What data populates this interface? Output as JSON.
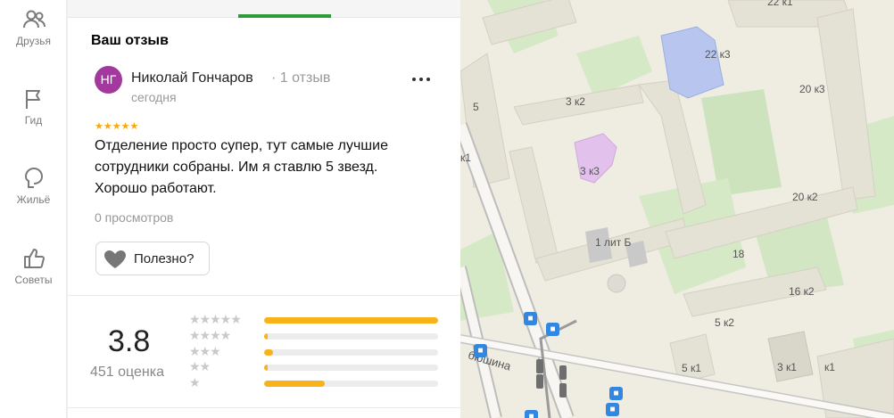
{
  "sidebar": {
    "items": [
      {
        "label": "Друзья",
        "icon": "friends-icon"
      },
      {
        "label": "Гид",
        "icon": "flag-icon"
      },
      {
        "label": "Жильё",
        "icon": "house-icon"
      },
      {
        "label": "Советы",
        "icon": "thumbs-up-icon"
      }
    ]
  },
  "review": {
    "section_title": "Ваш отзыв",
    "avatar_initials": "НГ",
    "avatar_color": "#a3389f",
    "author": "Николай Гончаров",
    "author_meta": "· 1 отзыв",
    "date": "сегодня",
    "stars": "★★★★★",
    "rating": 5,
    "text": "Отделение просто супер, тут самые лучшие сотрудники собраны. Им я ставлю 5 звезд. Хорошо работают.",
    "views": "0 просмотров",
    "useful_label": "Полезно?"
  },
  "summary": {
    "rating_value": "3.8",
    "rating_count": "451 оценка",
    "distribution": [
      {
        "stars": "★★★★★",
        "fraction": 1.0
      },
      {
        "stars": "★★★★",
        "fraction": 0.02
      },
      {
        "stars": "★★★",
        "fraction": 0.05
      },
      {
        "stars": "★★",
        "fraction": 0.02
      },
      {
        "stars": "★",
        "fraction": 0.35
      }
    ]
  },
  "colors": {
    "accent_green": "#2f9a3a",
    "star_yellow": "#f7a90f",
    "bar_yellow": "#f7b319"
  },
  "map": {
    "labels": [
      "22 к3",
      "20 к3",
      "3 к2",
      "3 к3",
      "5",
      "к1",
      "20 к2",
      "1 лит Б",
      "18",
      "16 к2",
      "5 к2",
      "5 к1",
      "3 к1",
      "к1",
      "бюшина",
      "22 к1"
    ]
  }
}
